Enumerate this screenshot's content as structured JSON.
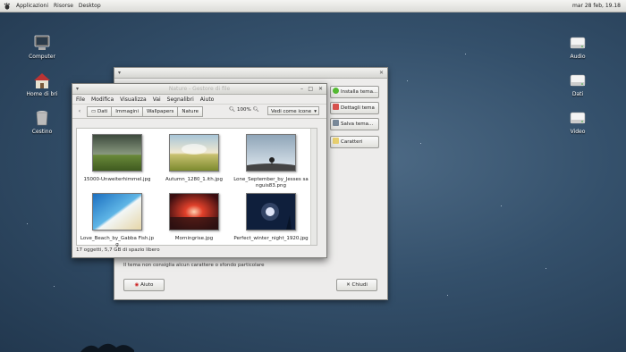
{
  "top_panel": {
    "menus": [
      "Applicazioni",
      "Risorse",
      "Desktop"
    ],
    "clock": "mar 28 feb, 19.18"
  },
  "desktop_icons": {
    "computer": "Computer",
    "home": "Home di bri",
    "trash": "Cestino",
    "audio": "Audio",
    "dati": "Dati",
    "video": "Video"
  },
  "dialog": {
    "side_buttons": {
      "install": "Installa tema...",
      "details": "Dettagli tema",
      "save": "Salva tema...",
      "fonts": "Caratteri"
    },
    "description": "Il tema non consiglia alcun carattere o sfondo particolare",
    "help_button": "Aiuto",
    "close_button": "Chiudi"
  },
  "file_manager": {
    "title": "Nature - Gestore di file",
    "menu": [
      "File",
      "Modifica",
      "Visualizza",
      "Vai",
      "Segnalibri",
      "Aiuto"
    ],
    "breadcrumb": [
      "Dati",
      "Immagini",
      "Wallpapers",
      "Nature"
    ],
    "zoom": "100%",
    "view_mode": "Vedi come icone",
    "files": [
      {
        "name": "15000-Unweiterhimmel.jpg",
        "img": "storm"
      },
      {
        "name": "Autumn_1280_1.ith.jpg",
        "img": "field"
      },
      {
        "name": "Lone_September_by_Jesses sanguis83.png",
        "img": "tree"
      },
      {
        "name": "Love_Beach_by_Gabba Fish.jpg",
        "img": "beach"
      },
      {
        "name": "Morningrise.jpg",
        "img": "sunrise"
      },
      {
        "name": "Perfect_winter_night_1920.jpg",
        "img": "moon"
      }
    ],
    "status": "17 oggetti, 5,7 GB di spazio libero"
  },
  "colors": {
    "desktop": "#34506b",
    "window_bg": "#edeceb"
  }
}
